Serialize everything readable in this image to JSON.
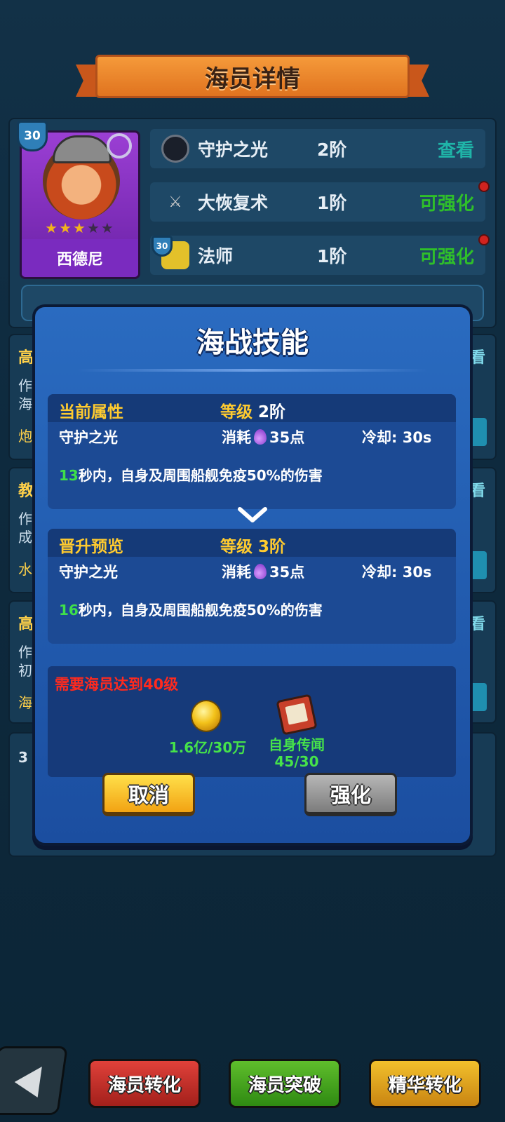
{
  "header": {
    "title": "海员详情"
  },
  "hero": {
    "name": "西德尼",
    "level": "30",
    "stars_filled": 3,
    "stars_total": 5
  },
  "skills": [
    {
      "name": "守护之光",
      "tier": "2阶",
      "action": "查看",
      "action_color": "#1fb4a8",
      "icon": "shield-orb-icon",
      "badge": null
    },
    {
      "name": "大恢复术",
      "tier": "1阶",
      "action": "可强化",
      "action_color": "#2fbf2a",
      "icon": "crossed-swords-icon",
      "badge": null
    },
    {
      "name": "法师",
      "tier": "1阶",
      "action": "可强化",
      "action_color": "#2fbf2a",
      "icon": "mage-icon",
      "badge": "30"
    }
  ],
  "bg_cards": [
    {
      "left": "高",
      "right": "看",
      "lines": [
        "作",
        "海"
      ],
      "tail": "炮"
    },
    {
      "left": "教",
      "right": "看",
      "lines": [
        "作",
        "成"
      ],
      "tail": "水"
    },
    {
      "left": "高",
      "right": "看",
      "lines": [
        "作",
        "初"
      ],
      "tail": "海"
    }
  ],
  "bg_card4_text": "3",
  "modal": {
    "title": "海战技能",
    "current": {
      "label": "当前属性",
      "level_label": "等级",
      "level": "2阶",
      "skill": "守护之光",
      "cost_label": "消耗",
      "cost": "35点",
      "cooldown": "冷却: 30s",
      "desc_num": "13",
      "desc_text": "秒内，自身及周围船舰免疫50%的伤害"
    },
    "preview": {
      "label": "晋升预览",
      "level_label": "等级",
      "level": "3阶",
      "skill": "守护之光",
      "cost_label": "消耗",
      "cost": "35点",
      "cooldown": "冷却: 30s",
      "desc_num": "16",
      "desc_text": "秒内，自身及周围船舰免疫50%的伤害"
    },
    "requirement": "需要海员达到40级",
    "materials": [
      {
        "icon": "gold-coin-icon",
        "value": "1.6亿/30万"
      },
      {
        "icon": "legend-book-icon",
        "name": "自身传闻",
        "value": "45/30"
      }
    ],
    "cancel": "取消",
    "upgrade": "强化"
  },
  "nav": {
    "convert": "海员转化",
    "breakthrough": "海员突破",
    "essence": "精华转化"
  },
  "colors": {
    "accent_gold": "#ffcb2f",
    "green_num": "#3fe04a",
    "requirement_red": "#ff2a1e"
  }
}
